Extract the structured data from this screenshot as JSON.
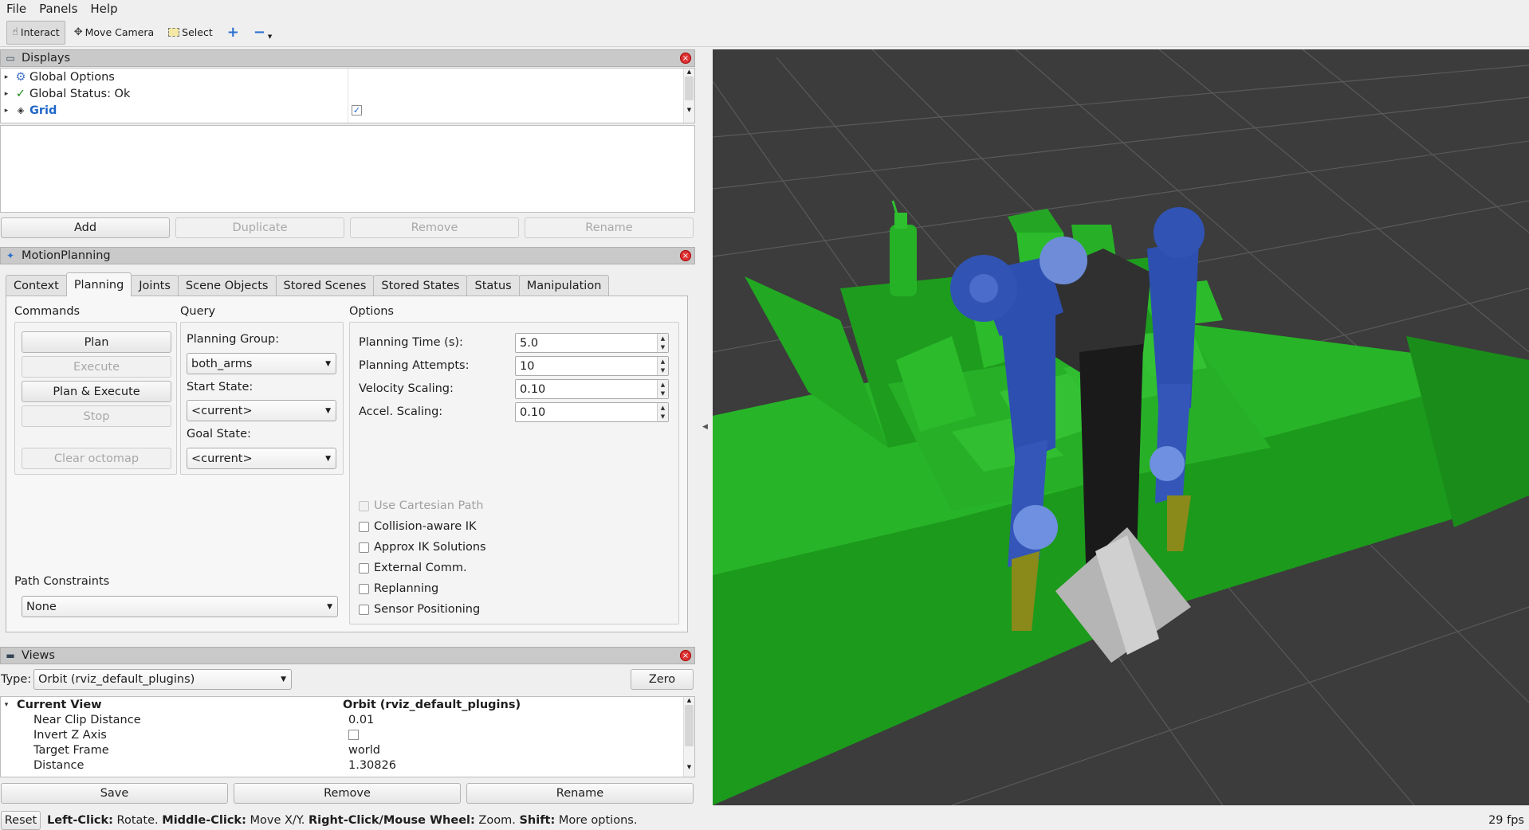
{
  "menu": [
    "File",
    "Panels",
    "Help"
  ],
  "toolbar": {
    "interact": "Interact",
    "move_camera": "Move Camera",
    "select": "Select"
  },
  "displays": {
    "title": "Displays",
    "items": [
      {
        "label": "Global Options"
      },
      {
        "label": "Global Status: Ok"
      },
      {
        "label": "Grid",
        "checked": true
      }
    ],
    "buttons": {
      "add": "Add",
      "duplicate": "Duplicate",
      "remove": "Remove",
      "rename": "Rename"
    }
  },
  "motion": {
    "title": "MotionPlanning",
    "tabs": [
      "Context",
      "Planning",
      "Joints",
      "Scene Objects",
      "Stored Scenes",
      "Stored States",
      "Status",
      "Manipulation"
    ],
    "commands_label": "Commands",
    "commands": {
      "plan": "Plan",
      "execute": "Execute",
      "plan_execute": "Plan & Execute",
      "stop": "Stop",
      "clear_octomap": "Clear octomap"
    },
    "query_label": "Query",
    "planning_group_label": "Planning Group:",
    "planning_group": "both_arms",
    "start_state_label": "Start State:",
    "start_state": "<current>",
    "goal_state_label": "Goal State:",
    "goal_state": "<current>",
    "options_label": "Options",
    "planning_time_label": "Planning Time (s):",
    "planning_time": "5.0",
    "planning_attempts_label": "Planning Attempts:",
    "planning_attempts": "10",
    "velocity_label": "Velocity Scaling:",
    "velocity": "0.10",
    "accel_label": "Accel. Scaling:",
    "accel": "0.10",
    "checks": {
      "cartesian": "Use Cartesian Path",
      "collision_ik": "Collision-aware IK",
      "approx_ik": "Approx IK Solutions",
      "external": "External Comm.",
      "replanning": "Replanning",
      "sensor": "Sensor Positioning"
    },
    "path_constraints_label": "Path Constraints",
    "path_constraints": "None"
  },
  "views": {
    "title": "Views",
    "type_label": "Type:",
    "type": "Orbit (rviz_default_plugins)",
    "zero": "Zero",
    "current_view": "Current View",
    "current_view_value": "Orbit (rviz_default_plugins)",
    "props": [
      {
        "k": "Near Clip Distance",
        "v": "0.01"
      },
      {
        "k": "Invert Z Axis",
        "v": ""
      },
      {
        "k": "Target Frame",
        "v": "world"
      },
      {
        "k": "Distance",
        "v": "1.30826"
      }
    ],
    "buttons": {
      "save": "Save",
      "remove": "Remove",
      "rename": "Rename"
    }
  },
  "status": {
    "reset": "Reset",
    "left": "Left-Click:",
    "left_t": " Rotate. ",
    "middle": "Middle-Click:",
    "middle_t": " Move X/Y. ",
    "right": "Right-Click/Mouse Wheel:",
    "right_t": " Zoom. ",
    "shift": "Shift:",
    "shift_t": " More options.",
    "fps": "29 fps"
  },
  "colors": {
    "scene_bg": "#3c3c3c",
    "green": "#1fa51f",
    "robot_blue": "#2d4fb0",
    "highlight_text": "#1f67c8"
  }
}
